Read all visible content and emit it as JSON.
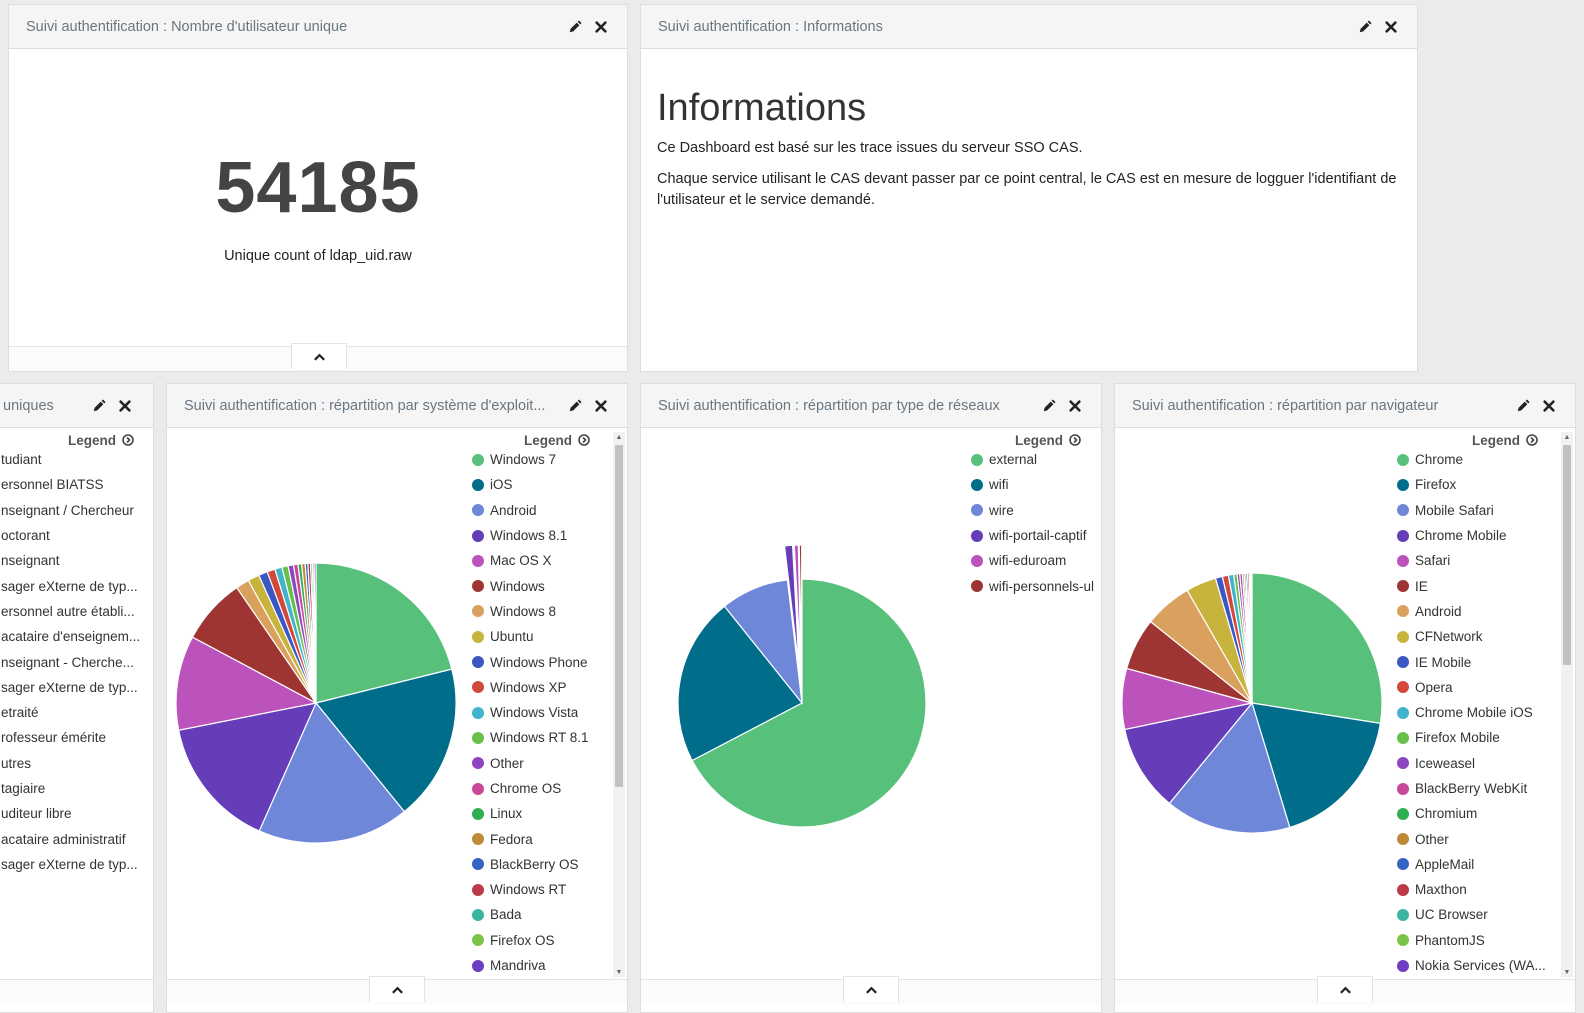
{
  "colors": {
    "palette": [
      "#57c17b",
      "#006e8a",
      "#6f87d8",
      "#663db8",
      "#bc52bc",
      "#9e3533",
      "#daa05d",
      "#c8b43c",
      "#3b57c4",
      "#d2493c",
      "#40b4cc",
      "#68bf4a",
      "#8e45c0",
      "#c8479a",
      "#2fae52",
      "#be8a3a",
      "#3465c5",
      "#bb3a46",
      "#3ab5a0",
      "#7bc44a",
      "#6d3ec3"
    ]
  },
  "panels": {
    "metric": {
      "title": "Suivi authentification : Nombre d'utilisateur unique",
      "value": "54185",
      "label": "Unique count of ldap_uid.raw"
    },
    "info": {
      "title": "Suivi authentification : Informations",
      "heading": "Informations",
      "paragraph1": "Ce Dashboard est basé sur les trace issues du serveur SSO CAS.",
      "paragraph2": "Chaque service utilisant le CAS devant passer par ce point central, le CAS est en mesure de logguer l'identifiant de l'utilisateur et le service demandé."
    },
    "users": {
      "title": "uniques",
      "legend_title": "Legend",
      "legend": [
        "tudiant",
        "ersonnel BIATSS",
        "nseignant / Chercheur",
        "octorant",
        "nseignant",
        "sager eXterne de typ...",
        "ersonnel autre établi...",
        "acataire d'enseignem...",
        "nseignant - Cherche...",
        "sager eXterne de typ...",
        "etraité",
        "rofesseur émérite",
        "utres",
        "tagiaire",
        "uditeur libre",
        "acataire administratif",
        "sager eXterne de typ..."
      ]
    },
    "os": {
      "title": "Suivi authentification : répartition par système d'exploit...",
      "legend_title": "Legend",
      "legend": [
        "Windows 7",
        "iOS",
        "Android",
        "Windows 8.1",
        "Mac OS X",
        "Windows",
        "Windows 8",
        "Ubuntu",
        "Windows Phone",
        "Windows XP",
        "Windows Vista",
        "Windows RT 8.1",
        "Other",
        "Chrome OS",
        "Linux",
        "Fedora",
        "BlackBerry OS",
        "Windows RT",
        "Bada",
        "Firefox OS",
        "Mandriva"
      ]
    },
    "network": {
      "title": "Suivi authentification : répartition par type de réseaux",
      "legend_title": "Legend",
      "legend": [
        "external",
        "wifi",
        "wire",
        "wifi-portail-captif",
        "wifi-eduroam",
        "wifi-personnels-ul"
      ]
    },
    "browser": {
      "title": "Suivi authentification : répartition par navigateur",
      "legend_title": "Legend",
      "legend": [
        "Chrome",
        "Firefox",
        "Mobile Safari",
        "Chrome Mobile",
        "Safari",
        "IE",
        "Android",
        "CFNetwork",
        "IE Mobile",
        "Opera",
        "Chrome Mobile iOS",
        "Firefox Mobile",
        "Iceweasel",
        "BlackBerry WebKit",
        "Chromium",
        "Other",
        "AppleMail",
        "Maxthon",
        "UC Browser",
        "PhantomJS",
        "Nokia Services (WA..."
      ]
    }
  },
  "chart_data": [
    {
      "type": "pie",
      "categories": [
        "Windows 7",
        "iOS",
        "Android",
        "Windows 8.1",
        "Mac OS X",
        "Windows",
        "Windows 8",
        "Ubuntu",
        "Windows Phone",
        "Windows XP",
        "Windows Vista",
        "Windows RT 8.1",
        "Other",
        "Chrome OS",
        "Linux",
        "Fedora",
        "BlackBerry OS",
        "Windows RT",
        "Bada",
        "Firefox OS",
        "Mandriva"
      ],
      "values": [
        20.5,
        17.5,
        17.0,
        14.8,
        10.6,
        7.4,
        1.5,
        1.3,
        1.0,
        0.9,
        0.8,
        0.7,
        0.6,
        0.5,
        0.4,
        0.4,
        0.3,
        0.3,
        0.2,
        0.2,
        0.2
      ]
    },
    {
      "type": "pie",
      "categories": [
        "external",
        "wifi",
        "wire",
        "wifi-portail-captif",
        "wifi-eduroam",
        "wifi-personnels-ul"
      ],
      "values": [
        64.5,
        21.0,
        8.5,
        1.0,
        0.5,
        0.3
      ]
    },
    {
      "type": "pie",
      "categories": [
        "Chrome",
        "Firefox",
        "Mobile Safari",
        "Chrome Mobile",
        "Safari",
        "IE",
        "Android",
        "CFNetwork",
        "IE Mobile",
        "Opera",
        "Chrome Mobile iOS",
        "Firefox Mobile",
        "Iceweasel",
        "BlackBerry WebKit",
        "Chromium",
        "Other",
        "AppleMail",
        "Maxthon",
        "UC Browser",
        "PhantomJS",
        "Nokia Services (WA..."
      ],
      "values": [
        25.5,
        16.5,
        14.5,
        10.0,
        7.0,
        6.0,
        5.5,
        3.5,
        0.8,
        0.7,
        0.6,
        0.4,
        0.3,
        0.3,
        0.2,
        0.2,
        0.2,
        0.2,
        0.1,
        0.1,
        0.1
      ]
    }
  ]
}
